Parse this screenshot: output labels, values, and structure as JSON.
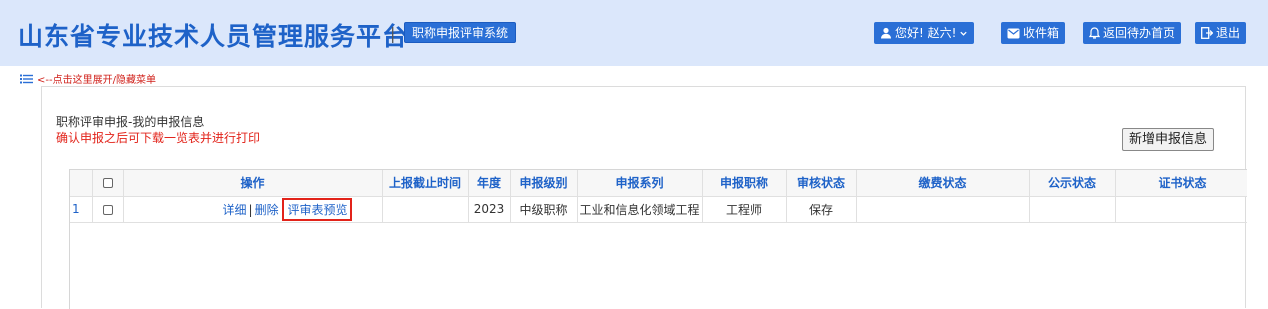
{
  "header": {
    "title": "山东省专业技术人员管理服务平台",
    "separator": "|",
    "system_badge": "职称申报评审系统",
    "user_greeting": "您好! 赵六!",
    "inbox_label": "收件箱",
    "back_home_label": "返回待办首页",
    "logout_label": "退出"
  },
  "menu_toggle": {
    "label": "<--点击这里展开/隐藏菜单"
  },
  "panel": {
    "title": "职称评审申报-我的申报信息",
    "note": "确认申报之后可下载一览表并进行打印",
    "add_button": "新增申报信息"
  },
  "table": {
    "columns": [
      "",
      "",
      "操作",
      "上报截止时间",
      "年度",
      "申报级别",
      "申报系列",
      "申报职称",
      "审核状态",
      "缴费状态",
      "公示状态",
      "证书状态"
    ],
    "rows": [
      {
        "index": "1",
        "actions": {
          "detail": "详细",
          "delete": "删除",
          "preview": "评审表预览",
          "separator": "|"
        },
        "deadline": "",
        "year": "2023",
        "level": "中级职称",
        "series": "工业和信息化领域工程",
        "title": "工程师",
        "review_status": "保存",
        "payment_status": "",
        "publicity_status": "",
        "certificate_status": ""
      }
    ]
  },
  "colors": {
    "accent": "#2a6fd6",
    "header_bg": "#dbe7fb",
    "title": "#1e62c8",
    "alert": "#e2231a"
  }
}
